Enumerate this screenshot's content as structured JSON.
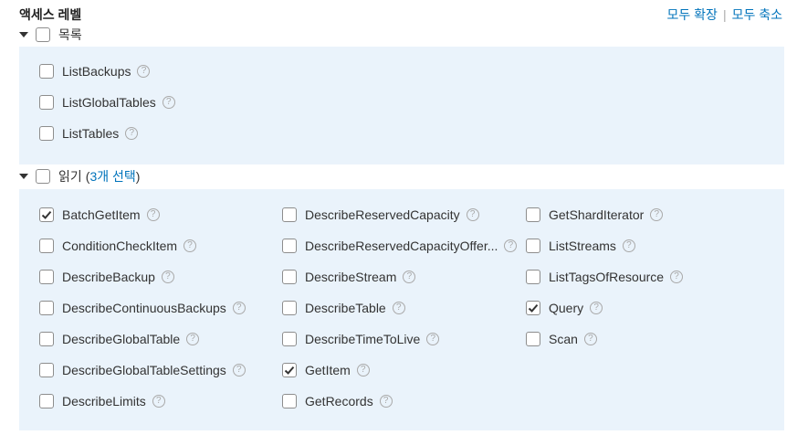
{
  "header": {
    "title": "액세스 레벨",
    "expand_all": "모두 확장",
    "separator": "|",
    "collapse_all": "모두 축소"
  },
  "groups": {
    "list": {
      "label": "목록",
      "items": [
        "ListBackups",
        "ListGlobalTables",
        "ListTables"
      ]
    },
    "read": {
      "label": "읽기",
      "count_open": "(",
      "count_text": "3개 선택",
      "count_close": ")",
      "col1": [
        {
          "label": "BatchGetItem",
          "checked": true
        },
        {
          "label": "ConditionCheckItem",
          "checked": false
        },
        {
          "label": "DescribeBackup",
          "checked": false
        },
        {
          "label": "DescribeContinuousBackups",
          "checked": false
        },
        {
          "label": "DescribeGlobalTable",
          "checked": false
        },
        {
          "label": "DescribeGlobalTableSettings",
          "checked": false
        },
        {
          "label": "DescribeLimits",
          "checked": false
        }
      ],
      "col2": [
        {
          "label": "DescribeReservedCapacity",
          "checked": false
        },
        {
          "label": "DescribeReservedCapacityOffer...",
          "checked": false
        },
        {
          "label": "DescribeStream",
          "checked": false
        },
        {
          "label": "DescribeTable",
          "checked": false
        },
        {
          "label": "DescribeTimeToLive",
          "checked": false
        },
        {
          "label": "GetItem",
          "checked": true
        },
        {
          "label": "GetRecords",
          "checked": false
        }
      ],
      "col3": [
        {
          "label": "GetShardIterator",
          "checked": false
        },
        {
          "label": "ListStreams",
          "checked": false
        },
        {
          "label": "ListTagsOfResource",
          "checked": false
        },
        {
          "label": "Query",
          "checked": true
        },
        {
          "label": "Scan",
          "checked": false
        }
      ]
    }
  },
  "help_glyph": "?",
  "colors": {
    "link": "#0073bb",
    "panel_bg": "#eaf3fb",
    "check": "#333333"
  }
}
